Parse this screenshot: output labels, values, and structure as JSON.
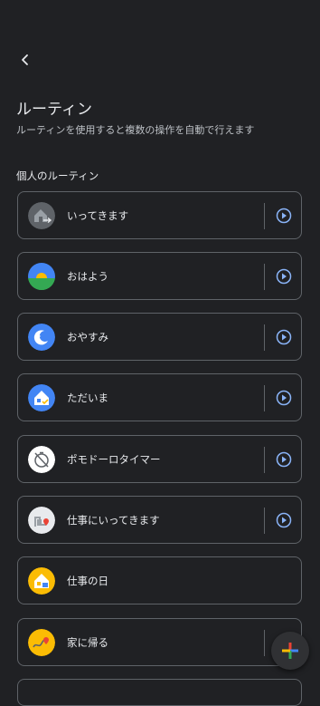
{
  "header": {
    "back_icon": "chevron-left-icon",
    "title": "ルーティン",
    "subtitle": "ルーティンを使用すると複数の操作を自動で行えます"
  },
  "personal": {
    "section_title": "個人のルーティン",
    "routines": [
      {
        "label": "いってきます",
        "icon": "home-leave-icon",
        "has_play": true
      },
      {
        "label": "おはよう",
        "icon": "sunrise-icon",
        "has_play": true
      },
      {
        "label": "おやすみ",
        "icon": "moon-icon",
        "has_play": true
      },
      {
        "label": "ただいま",
        "icon": "home-arrive-icon",
        "has_play": true
      },
      {
        "label": "ポモドーロタイマー",
        "icon": "timer-off-icon",
        "has_play": true
      },
      {
        "label": "仕事にいってきます",
        "icon": "commute-map-icon",
        "has_play": true
      },
      {
        "label": "仕事の日",
        "icon": "work-home-icon",
        "has_play": false
      },
      {
        "label": "家に帰る",
        "icon": "route-home-icon",
        "has_play": true
      }
    ]
  },
  "fab": {
    "icon": "google-plus-icon"
  },
  "colors": {
    "background": "#202124",
    "card_border": "#5f6368",
    "play_accent": "#8ab4f8",
    "google_blue": "#4285f4",
    "google_red": "#ea4335",
    "google_yellow": "#fbbc04",
    "google_green": "#34a853"
  }
}
